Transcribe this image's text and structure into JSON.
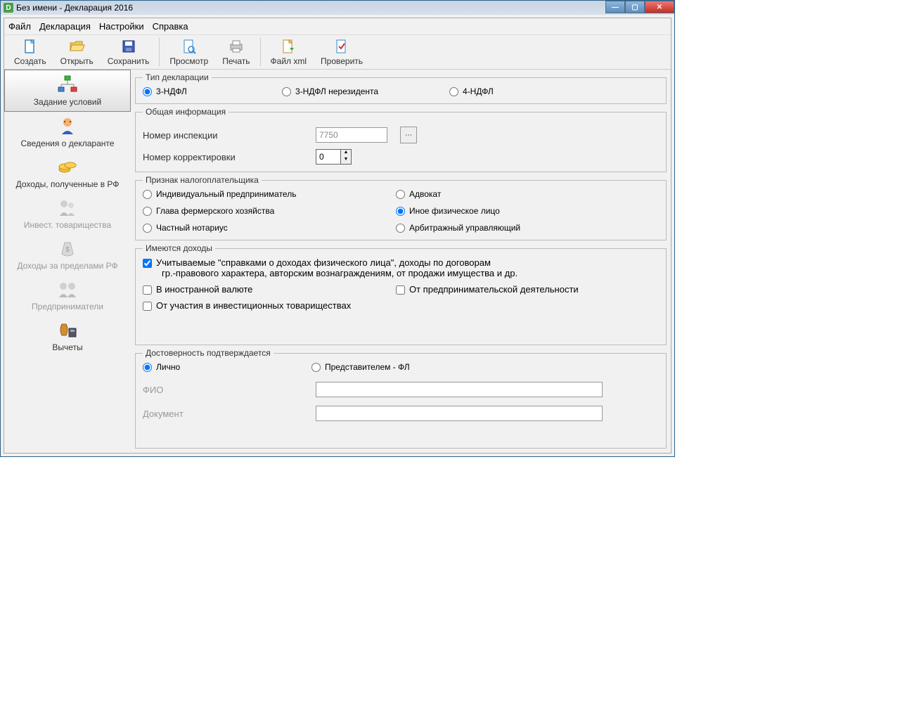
{
  "titlebar": {
    "text": "Без имени - Декларация 2016"
  },
  "menu": {
    "file": "Файл",
    "decl": "Декларация",
    "settings": "Настройки",
    "help": "Справка"
  },
  "toolbar": {
    "create": "Создать",
    "open": "Открыть",
    "save": "Сохранить",
    "preview": "Просмотр",
    "print": "Печать",
    "filexml": "Файл xml",
    "check": "Проверить"
  },
  "sidebar": {
    "conditions": "Задание условий",
    "declarant": "Сведения о декларанте",
    "income_rf": "Доходы, полученные в РФ",
    "invest": "Инвест. товарищества",
    "income_abroad": "Доходы за пределами РФ",
    "entrepreneurs": "Предприниматели",
    "deductions": "Вычеты"
  },
  "decl_type": {
    "legend": "Тип декларации",
    "opt1": "3-НДФЛ",
    "opt2": "3-НДФЛ нерезидента",
    "opt3": "4-НДФЛ"
  },
  "general": {
    "legend": "Общая информация",
    "inspection_label": "Номер инспекции",
    "inspection_value": "7750",
    "correction_label": "Номер корректировки",
    "correction_value": "0"
  },
  "taxpayer": {
    "legend": "Признак налогоплательщика",
    "ip": "Индивидуальный предприниматель",
    "lawyer": "Адвокат",
    "farm": "Глава фермерского хозяйства",
    "other": "Иное физическое лицо",
    "notary": "Частный нотариус",
    "arbit": "Арбитражный управляющий"
  },
  "income": {
    "legend": "Имеются доходы",
    "spravka": "Учитываемые \"справками о доходах физического лица\", доходы по договорам",
    "spravka2": "гр.-правового характера, авторским вознаграждениям, от продажи имущества и др.",
    "foreign": "В иностранной валюте",
    "business": "От предпринимательской деятельности",
    "invest": "От участия в инвестиционных товариществах"
  },
  "auth": {
    "legend": "Достоверность подтверждается",
    "personal": "Лично",
    "rep": "Представителем - ФЛ",
    "fio": "ФИО",
    "doc": "Документ"
  }
}
